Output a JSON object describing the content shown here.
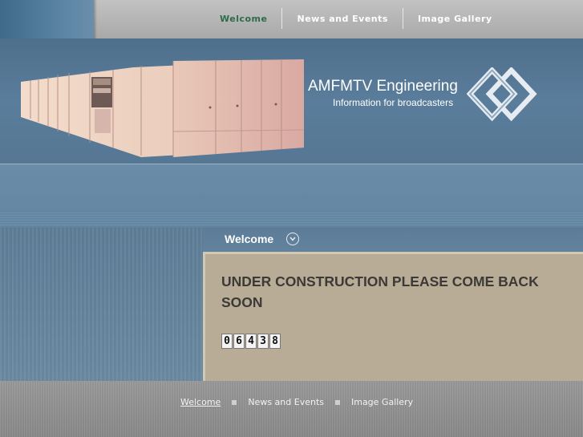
{
  "top_nav": {
    "items": [
      {
        "label": "Welcome",
        "active": true
      },
      {
        "label": "News and Events",
        "active": false
      },
      {
        "label": "Image Gallery",
        "active": false
      }
    ]
  },
  "header": {
    "title": "AMFMTV Engineering",
    "subtitle": "Information for broadcasters",
    "logo_icon": "diamond-logo-icon"
  },
  "section": {
    "title": "Welcome",
    "toggle_icon": "chevron-down-icon"
  },
  "content": {
    "headline": "UNDER CONSTRUCTION PLEASE COME BACK SOON",
    "counter_digits": [
      "0",
      "6",
      "4",
      "3",
      "8"
    ]
  },
  "footer_nav": {
    "items": [
      {
        "label": "Welcome",
        "active": true
      },
      {
        "label": "News and Events",
        "active": false
      },
      {
        "label": "Image Gallery",
        "active": false
      }
    ]
  },
  "colors": {
    "active_nav": "#2f6b4a",
    "content_bg": "#b8ac96",
    "header_bg": "#557794"
  }
}
